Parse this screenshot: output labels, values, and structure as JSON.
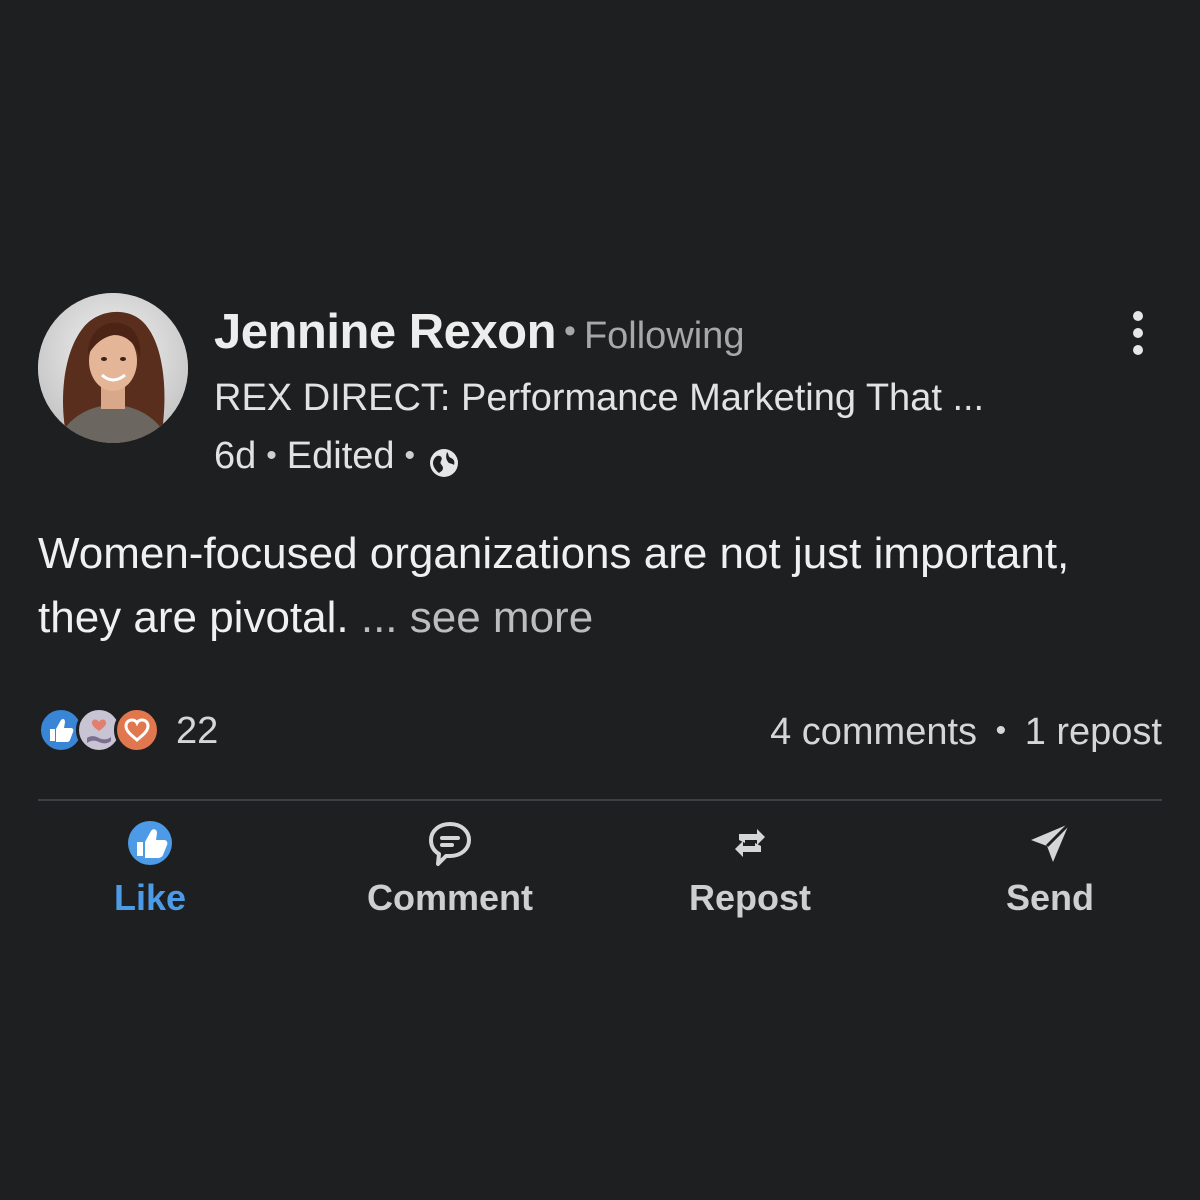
{
  "post": {
    "author": {
      "name": "Jennine Rexon",
      "follow_status": "Following",
      "headline": "REX DIRECT: Performance Marketing That ...",
      "age": "6d",
      "edited_label": "Edited",
      "visibility_icon": "globe-icon"
    },
    "text": {
      "body": "Women-focused organizations are not just important, they are pivotal.",
      "see_more": "... see more"
    },
    "reactions": {
      "icons": [
        "like-reaction-icon",
        "support-reaction-icon",
        "love-reaction-icon"
      ],
      "count": "22"
    },
    "engagement": {
      "comments": "4 comments",
      "reposts": "1 repost"
    },
    "actions": [
      {
        "label": "Like",
        "icon": "like-icon",
        "active": true
      },
      {
        "label": "Comment",
        "icon": "comment-icon",
        "active": false
      },
      {
        "label": "Repost",
        "icon": "repost-icon",
        "active": false
      },
      {
        "label": "Send",
        "icon": "send-icon",
        "active": false
      }
    ]
  },
  "colors": {
    "background": "#1d1f21",
    "accent_blue": "#4d9be6",
    "muted_text": "#a8a8a8",
    "love_orange": "#e1774e"
  }
}
